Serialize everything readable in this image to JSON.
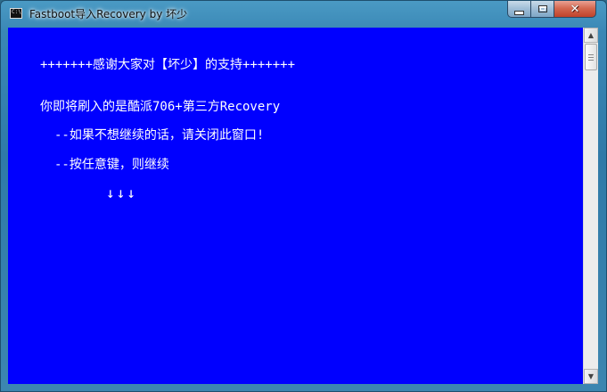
{
  "window": {
    "title": "Fastboot导入Recovery by 坏少",
    "icon_label": "C:\\",
    "controls": {
      "minimize_icon": "minimize-icon",
      "maximize_icon": "maximize-icon",
      "close_icon": "close-icon",
      "close_glyph": "✕"
    }
  },
  "console": {
    "background_color": "#0000ff",
    "text_color": "#ffffff",
    "lines": {
      "thanks": "+++++++感谢大家对【坏少】的支持+++++++",
      "flash_info": "你即将刷入的是酷派706+第三方Recovery",
      "cancel_hint": "--如果不想继续的话，请关闭此窗口!",
      "continue_hint": "--按任意键，则继续",
      "arrows": "↓↓↓"
    }
  },
  "scrollbar": {
    "up_arrow": "▲",
    "down_arrow": "▼"
  }
}
